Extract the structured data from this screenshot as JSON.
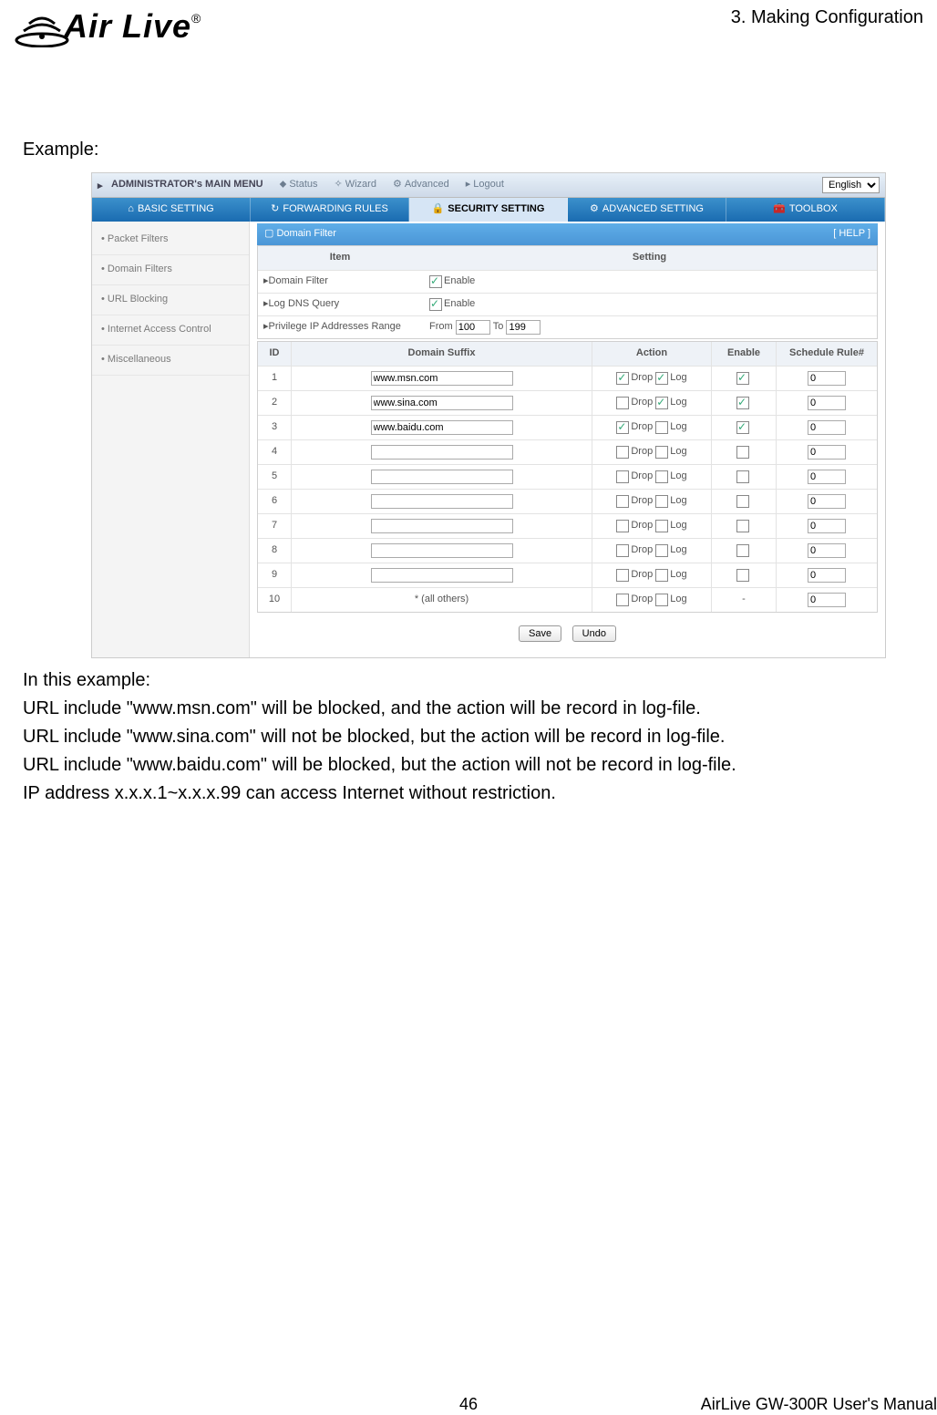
{
  "header": {
    "chapter": "3. Making Configuration",
    "brand": "Air Live",
    "tm": "®"
  },
  "labels": {
    "example": "Example:"
  },
  "screenshot": {
    "top_menu": {
      "admin": "ADMINISTRATOR's MAIN MENU",
      "status": "Status",
      "wizard": "Wizard",
      "advanced": "Advanced",
      "logout": "Logout",
      "lang": "English"
    },
    "tabs": {
      "basic": "BASIC SETTING",
      "fwd": "FORWARDING RULES",
      "sec": "SECURITY SETTING",
      "adv": "ADVANCED SETTING",
      "tool": "TOOLBOX"
    },
    "sidebar": {
      "packet": "Packet Filters",
      "domain": "Domain Filters",
      "url": "URL Blocking",
      "iac": "Internet Access Control",
      "misc": "Miscellaneous"
    },
    "panel": {
      "title": "Domain Filter",
      "help": "[ HELP ]"
    },
    "settings_header": {
      "item": "Item",
      "setting": "Setting"
    },
    "settings": {
      "df_label": "Domain Filter",
      "df_enable": "Enable",
      "ldq_label": "Log DNS Query",
      "ldq_enable": "Enable",
      "pir_label": "Privilege IP Addresses Range",
      "from": "From",
      "to": "To",
      "from_val": "100",
      "to_val": "199"
    },
    "th": {
      "id": "ID",
      "suffix": "Domain Suffix",
      "action": "Action",
      "enable": "Enable",
      "sr": "Schedule Rule#"
    },
    "rows": [
      {
        "id": "1",
        "suffix": "www.msn.com",
        "drop": true,
        "log": true,
        "enable": true,
        "sr": "0"
      },
      {
        "id": "2",
        "suffix": "www.sina.com",
        "drop": false,
        "log": true,
        "enable": true,
        "sr": "0"
      },
      {
        "id": "3",
        "suffix": "www.baidu.com",
        "drop": true,
        "log": false,
        "enable": true,
        "sr": "0"
      },
      {
        "id": "4",
        "suffix": "",
        "drop": false,
        "log": false,
        "enable": false,
        "sr": "0"
      },
      {
        "id": "5",
        "suffix": "",
        "drop": false,
        "log": false,
        "enable": false,
        "sr": "0"
      },
      {
        "id": "6",
        "suffix": "",
        "drop": false,
        "log": false,
        "enable": false,
        "sr": "0"
      },
      {
        "id": "7",
        "suffix": "",
        "drop": false,
        "log": false,
        "enable": false,
        "sr": "0"
      },
      {
        "id": "8",
        "suffix": "",
        "drop": false,
        "log": false,
        "enable": false,
        "sr": "0"
      },
      {
        "id": "9",
        "suffix": "",
        "drop": false,
        "log": false,
        "enable": false,
        "sr": "0"
      },
      {
        "id": "10",
        "suffix": "* (all others)",
        "drop": false,
        "log": false,
        "enable": "-",
        "sr": "0",
        "noinput": true
      }
    ],
    "act_labels": {
      "drop": "Drop",
      "log": "Log"
    },
    "buttons": {
      "save": "Save",
      "undo": "Undo"
    }
  },
  "body": {
    "l0": "In this example:",
    "l1": "URL include \"www.msn.com\" will be blocked, and the action will be record in log-file.",
    "l2": "URL include \"www.sina.com\" will not be blocked, but the action will be record in log-file.",
    "l3": "URL include \"www.baidu.com\" will be blocked, but the action will not be record in log-file.",
    "l4": "IP address x.x.x.1~x.x.x.99 can access Internet without restriction."
  },
  "footer": {
    "page": "46",
    "manual": "AirLive GW-300R User's Manual"
  }
}
